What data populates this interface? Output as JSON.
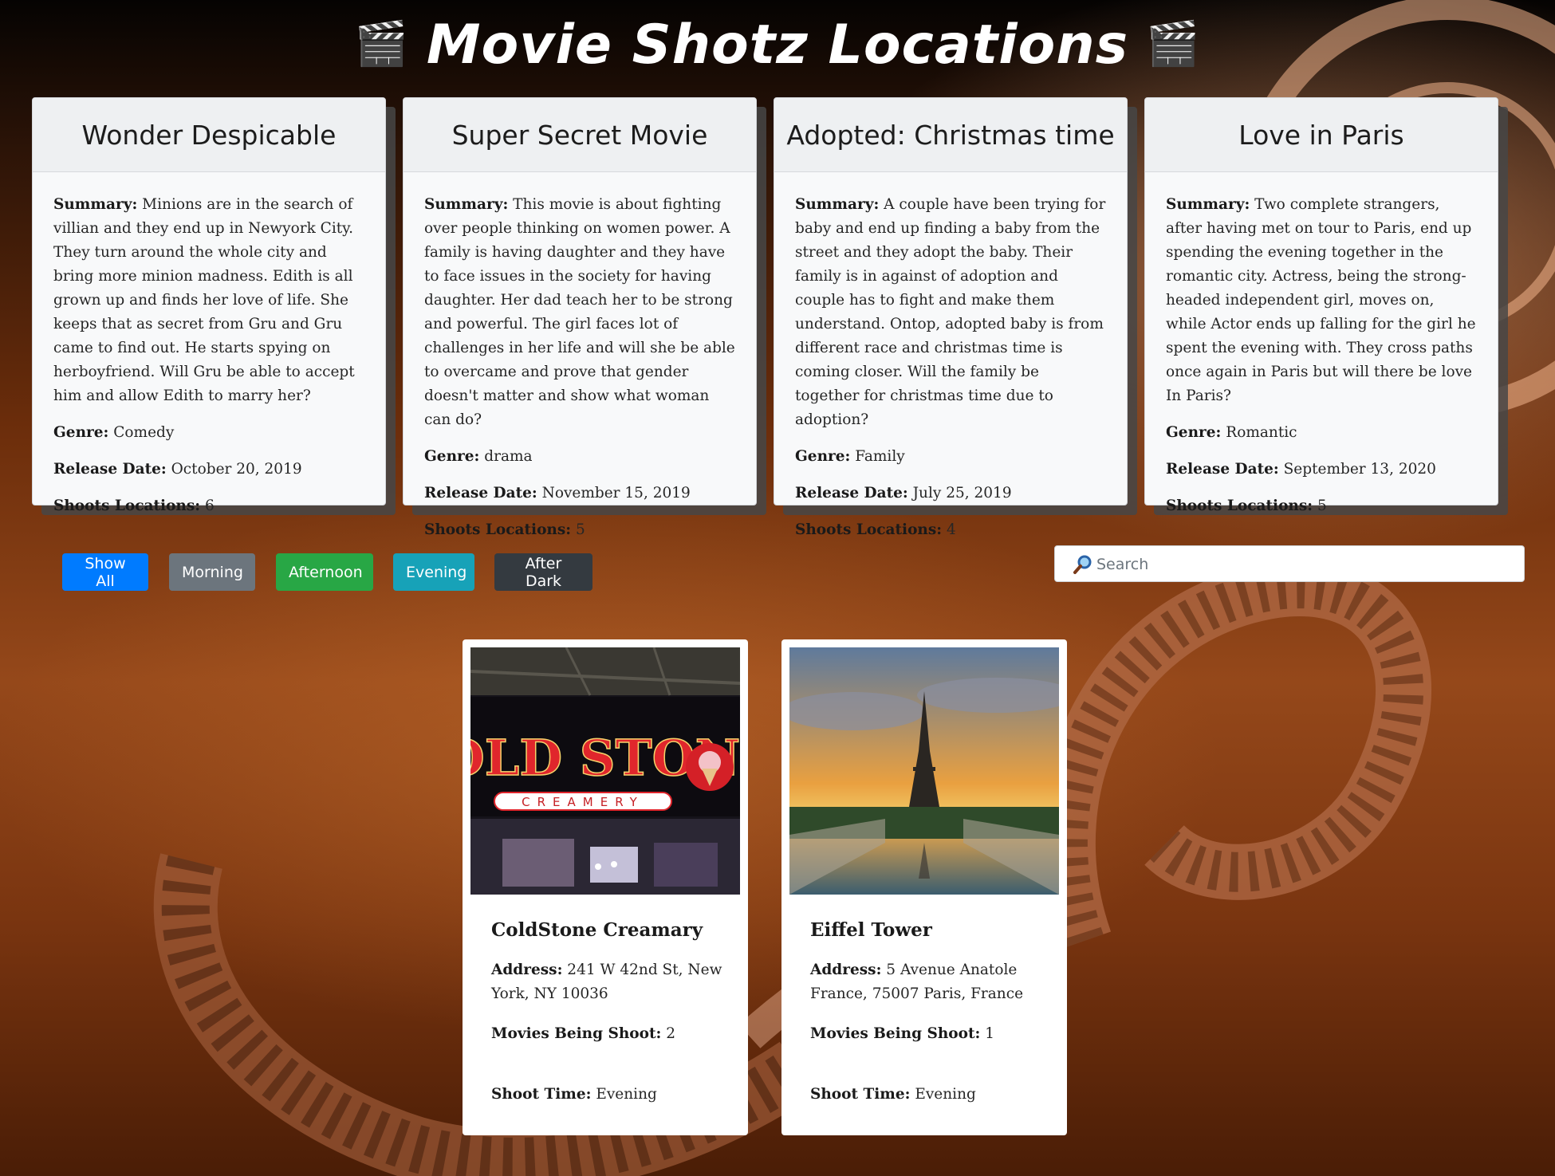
{
  "header": {
    "title": "Movie Shotz Locations",
    "clap_icon": "🎬"
  },
  "movies": [
    {
      "title": "Wonder Despicable",
      "summary_label": "Summary:",
      "summary": "Minions are in the search of villian and they end up in Newyork City. They turn around the whole city and bring more minion madness. Edith is all grown up and finds her love of life. She keeps that as secret from Gru and Gru came to find out. He starts spying on herboyfriend. Will Gru be able to accept him and allow Edith to marry her?",
      "genre_label": "Genre:",
      "genre": "Comedy",
      "release_label": "Release Date:",
      "release": "October 20, 2019",
      "shoots_label": "Shoots Locations:",
      "shoots": "6"
    },
    {
      "title": "Super Secret Movie",
      "summary_label": "Summary:",
      "summary": "This movie is about fighting over people thinking on women power. A family is having daughter and they have to face issues in the society for having daughter. Her dad teach her to be strong and powerful. The girl faces lot of challenges in her life and will she be able to overcame and prove that gender doesn't matter and show what woman can do?",
      "genre_label": "Genre:",
      "genre": "drama",
      "release_label": "Release Date:",
      "release": "November 15, 2019",
      "shoots_label": "Shoots Locations:",
      "shoots": "5"
    },
    {
      "title": "Adopted: Christmas time",
      "summary_label": "Summary:",
      "summary": "A couple have been trying for baby and end up finding a baby from the street and they adopt the baby. Their family is in against of adoption and couple has to fight and make them understand. Ontop, adopted baby is from different race and christmas time is coming closer. Will the family be together for christmas time due to adoption?",
      "genre_label": "Genre:",
      "genre": "Family",
      "release_label": "Release Date:",
      "release": "July 25, 2019",
      "shoots_label": "Shoots Locations:",
      "shoots": "4"
    },
    {
      "title": "Love in Paris",
      "summary_label": "Summary:",
      "summary": "Two complete strangers, after having met on tour to Paris, end up spending the evening together in the romantic city. Actress, being the strong-headed independent girl, moves on, while Actor ends up falling for the girl he spent the evening with. They cross paths once again in Paris but will there be love In Paris?",
      "genre_label": "Genre:",
      "genre": "Romantic",
      "release_label": "Release Date:",
      "release": "September 13, 2020",
      "shoots_label": "Shoots Locations:",
      "shoots": "5"
    }
  ],
  "filters": [
    {
      "label": "Show All",
      "color": "#007bff"
    },
    {
      "label": "Morning",
      "color": "#6c757d"
    },
    {
      "label": "Afternoon",
      "color": "#28a745"
    },
    {
      "label": "Evening",
      "color": "#17a2b8"
    },
    {
      "label": "After Dark",
      "color": "#343a40"
    }
  ],
  "search": {
    "placeholder": "Search",
    "icon": "magnifier-icon"
  },
  "locations": [
    {
      "name": "ColdStone Creamary",
      "sign_text": "COLD STONE",
      "sign_subtext": "CREAMERY",
      "address_label": "Address:",
      "address": "241 W 42nd St, New York, NY 10036",
      "movies_label": "Movies Being Shoot:",
      "movies": "2",
      "time_label": "Shoot Time:",
      "time": "Evening"
    },
    {
      "name": "Eiffel Tower",
      "address_label": "Address:",
      "address": "5 Avenue Anatole France, 75007 Paris, France",
      "movies_label": "Movies Being Shoot:",
      "movies": "1",
      "time_label": "Shoot Time:",
      "time": "Evening"
    }
  ]
}
